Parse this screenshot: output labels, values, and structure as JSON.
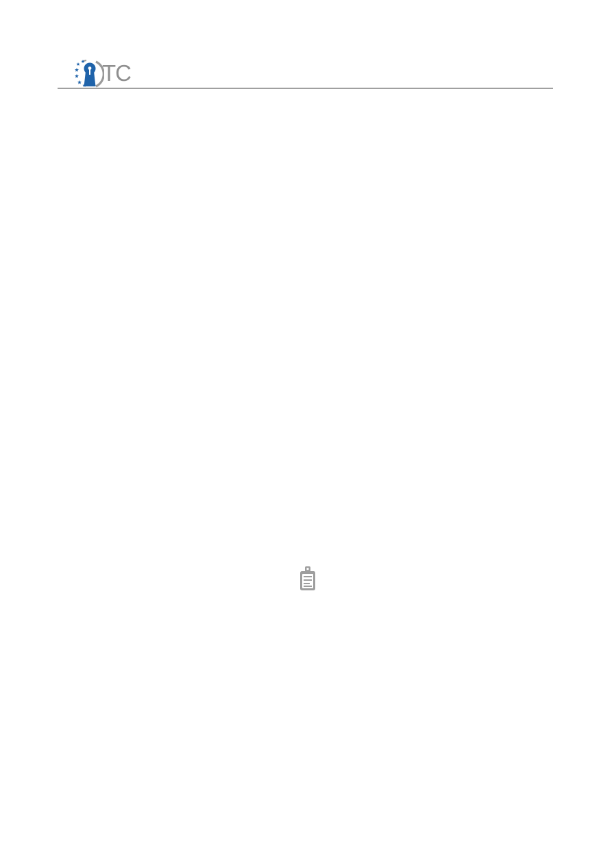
{
  "header": {
    "logo": {
      "text": "TC",
      "name": "ITC logo",
      "colors": {
        "keyhole": "#1f63aa",
        "stars": "#1f63aa",
        "ring": "#9a9a9a",
        "text": "#8f8f8f"
      }
    },
    "rule_color": "#222222"
  },
  "body": {
    "icon": "clipboard-icon",
    "icon_color": "#9e9e9e"
  }
}
